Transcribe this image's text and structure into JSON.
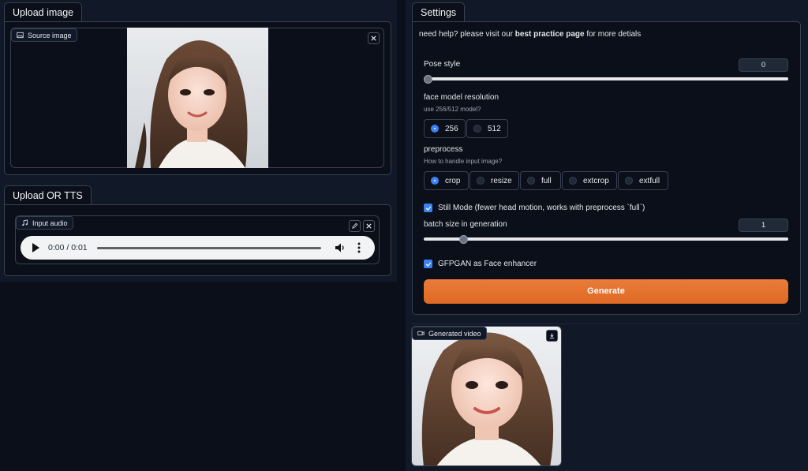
{
  "upload_image": {
    "tab_label": "Upload image",
    "source_label": "Source image",
    "source_icon": "image-icon",
    "clear_icon": "close-icon"
  },
  "upload_tts": {
    "tab_label": "Upload OR TTS",
    "input_label": "Input audio",
    "input_icon": "music-note-icon",
    "time": "0:00 / 0:01",
    "progress": 0
  },
  "settings": {
    "tab_label": "Settings",
    "help_prefix": "need help? please visit our ",
    "help_link": "best practice page",
    "help_suffix": " for more detials",
    "pose_style": {
      "label": "Pose style",
      "value": "0",
      "fraction": 0
    },
    "face_model": {
      "label": "face model resolution",
      "sublabel": "use 256/512 model?",
      "options": [
        "256",
        "512"
      ],
      "selected": "256"
    },
    "preprocess": {
      "label": "preprocess",
      "sublabel": "How to handle input image?",
      "options": [
        "crop",
        "resize",
        "full",
        "extcrop",
        "extfull"
      ],
      "selected": "crop"
    },
    "still_mode": {
      "label": "Still Mode (fewer head motion, works with preprocess `full`)",
      "checked": true
    },
    "batch_size": {
      "label": "batch size in generation",
      "value": "1",
      "fraction": 0.1
    },
    "gfpgan": {
      "label": "GFPGAN as Face enhancer",
      "checked": true
    },
    "generate_label": "Generate"
  },
  "output": {
    "video_label": "Generated video",
    "video_icon": "video-camera-icon",
    "download_icon": "download-icon"
  },
  "colors": {
    "background": "#0b0f19",
    "panel": "#111827",
    "border": "#374151",
    "accent": "#3b82f6",
    "generate": "#e3702d"
  }
}
